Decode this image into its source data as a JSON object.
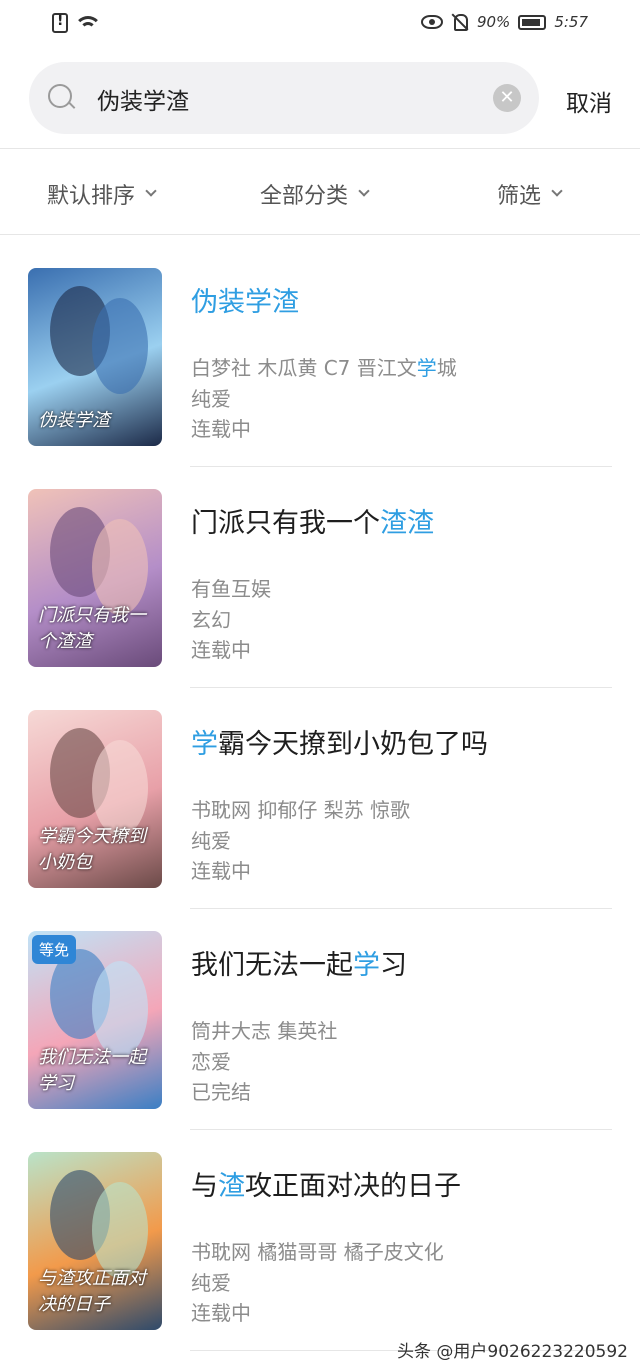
{
  "status_bar": {
    "battery": "90%",
    "time": "5:57"
  },
  "search": {
    "value": "伪装学渣",
    "cancel_label": "取消"
  },
  "filters": [
    {
      "label": "默认排序"
    },
    {
      "label": "全部分类"
    },
    {
      "label": "筛选"
    }
  ],
  "results": [
    {
      "title_parts": [
        "",
        "伪装学渣",
        ""
      ],
      "author_parts": [
        "白梦社 木瓜黄 C7 晋江文",
        "学",
        "城"
      ],
      "genre": "纯爱",
      "status": "连载中",
      "cover_text": "伪装学渣",
      "cover_colors": [
        "#3a6fb0",
        "#9bd0f0",
        "#1c2a48"
      ]
    },
    {
      "title_parts": [
        "门派只有我一个",
        "渣渣",
        ""
      ],
      "author_parts": [
        "有鱼互娱",
        "",
        ""
      ],
      "genre": "玄幻",
      "status": "连载中",
      "cover_text": "门派只有我一个渣渣",
      "cover_colors": [
        "#f0c2b8",
        "#b48ec8",
        "#6a4b7a"
      ]
    },
    {
      "title_parts": [
        "",
        "学",
        "霸今天撩到小奶包了吗"
      ],
      "author_parts": [
        "书耽网 抑郁仔 梨苏 惊歌",
        "",
        ""
      ],
      "genre": "纯爱",
      "status": "连载中",
      "cover_text": "学霸今天撩到小奶包",
      "cover_colors": [
        "#f6d9d6",
        "#e8a0a8",
        "#6b4a48"
      ]
    },
    {
      "title_parts": [
        "我们无法一起",
        "学",
        "习"
      ],
      "author_parts": [
        "筒井大志 集英社",
        "",
        ""
      ],
      "genre": "恋爱",
      "status": "已完结",
      "badge": "等免",
      "cover_text": "我们无法一起学习",
      "cover_colors": [
        "#bfe3f7",
        "#f4a6b8",
        "#3b7fc4"
      ]
    },
    {
      "title_parts": [
        "与",
        "渣",
        "攻正面对决的日子"
      ],
      "author_parts": [
        "书耽网 橘猫哥哥 橘子皮文化",
        "",
        ""
      ],
      "genre": "纯爱",
      "status": "连载中",
      "cover_text": "与渣攻正面对决的日子",
      "cover_colors": [
        "#b9e3c9",
        "#f29a4b",
        "#2e4a6b"
      ]
    }
  ],
  "watermark": "头条 @用户9026223220592",
  "accent_color": "#2f9ee2"
}
